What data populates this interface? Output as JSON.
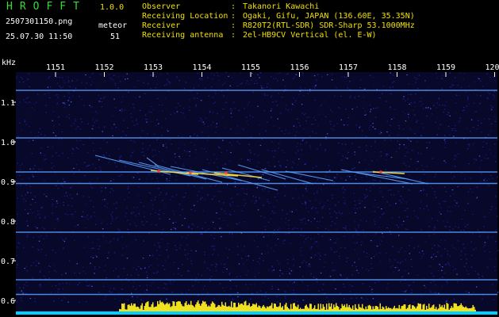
{
  "header": {
    "app_title": "HROFFT",
    "app_version": "1.0.0",
    "file_name": "2507301150.png",
    "datetime": "25.07.30 11:50",
    "meteor_label": "meteor",
    "meteor_count": "51",
    "colors": {
      "title": "#33dd33",
      "info": "#f0e000",
      "meta": "#ffffff"
    }
  },
  "info": [
    {
      "key": "Observer",
      "value": "Takanori Kawachi"
    },
    {
      "key": "Receiving Location",
      "value": "Ogaki, Gifu, JAPAN (136.60E, 35.35N)"
    },
    {
      "key": "Receiver",
      "value": "R820T2(RTL-SDR) SDR-Sharp 53.1000MHz"
    },
    {
      "key": "Receiving antenna",
      "value": "2el-HB9CV Vertical (el. E-W)"
    }
  ],
  "spectrogram": {
    "y_unit": "kHz",
    "y_ticks": [
      "1.1",
      "1.0",
      "0.9",
      "0.8",
      "0.7",
      "0.6"
    ],
    "time_ticks": [
      "1151",
      "1152",
      "1153",
      "1154",
      "1155",
      "1156",
      "1157",
      "1158",
      "1159",
      "1200"
    ],
    "carrier_lines_khz": [
      1.13,
      1.01,
      0.924,
      0.895,
      0.772,
      0.652,
      0.615
    ],
    "colors": {
      "background": "#08082a",
      "noise": "#2030c0",
      "carrier": "#5aa0ff",
      "meteor": "#ffe040",
      "axis": "#ffffff",
      "activity_bar": "#f0e020",
      "baseline": "#00d0ff"
    }
  }
}
